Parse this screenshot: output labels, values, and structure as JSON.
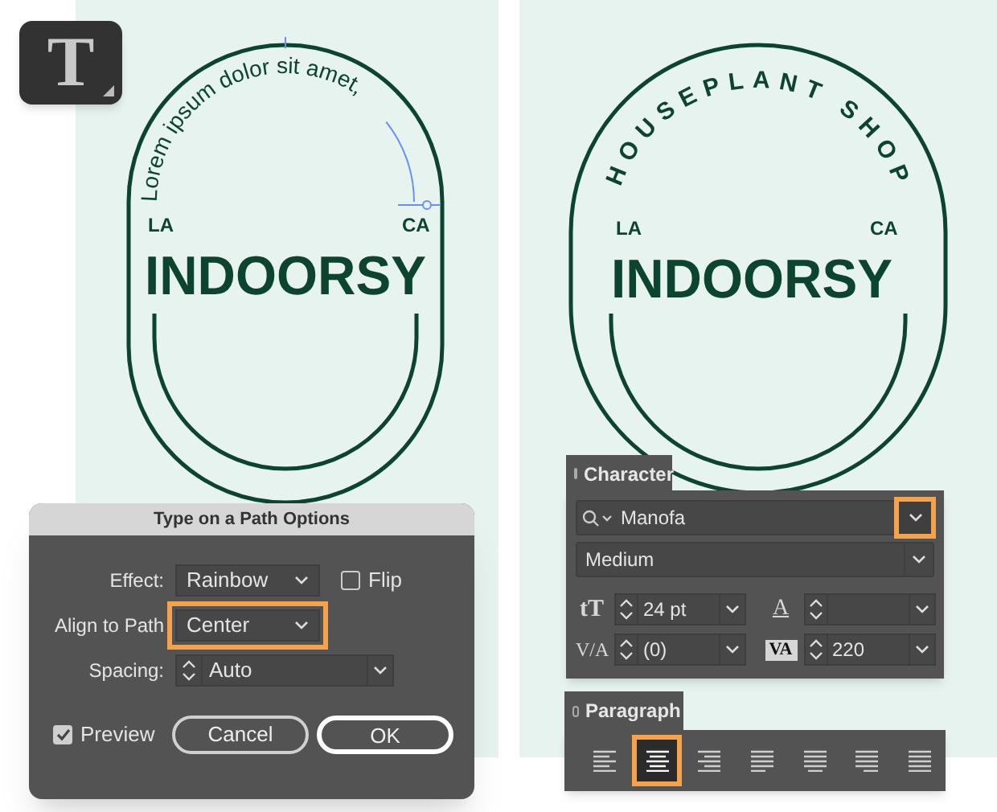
{
  "tool_icon": {
    "glyph": "T"
  },
  "artboards": [
    {
      "curved_text": "Lorem ipsum dolor sit amet,",
      "path_selected": true,
      "left_label": "LA",
      "right_label": "CA",
      "brand": "INDOORSY"
    },
    {
      "curved_text": "HOUSEPLANT SHOP",
      "path_selected": false,
      "left_label": "LA",
      "right_label": "CA",
      "brand": "INDOORSY"
    }
  ],
  "dialog": {
    "title": "Type on a Path Options",
    "fields": [
      {
        "kind": "select",
        "label": "Effect:",
        "value": "Rainbow",
        "highlighted": false
      },
      {
        "kind": "select",
        "label": "Align to Path",
        "value": "Center",
        "highlighted": true
      },
      {
        "kind": "stepper",
        "label": "Spacing:",
        "value": "Auto",
        "highlighted": false
      }
    ],
    "flip": {
      "label": "Flip",
      "checked": false
    },
    "preview": {
      "label": "Preview",
      "checked": true
    },
    "buttons": [
      {
        "label": "Cancel",
        "default": false
      },
      {
        "label": "OK",
        "default": true
      }
    ]
  },
  "character_panel": {
    "title": "Character",
    "font_family": {
      "value": "Manofa",
      "highlighted": true
    },
    "font_style": {
      "value": "Medium",
      "highlighted": false
    },
    "fields": [
      {
        "kind": "size",
        "icon": "tT",
        "value": "24 pt"
      },
      {
        "kind": "leading",
        "icon": "A"
      },
      {
        "kind": "kerning",
        "icon": "V/A",
        "value": "(0)"
      },
      {
        "kind": "tracking",
        "icon": "VA",
        "value": "220"
      }
    ]
  },
  "paragraph_panel": {
    "title": "Paragraph",
    "alignments": [
      {
        "kind": "left",
        "selected": false
      },
      {
        "kind": "center",
        "selected": true
      },
      {
        "kind": "right",
        "selected": false
      },
      {
        "kind": "justify-left",
        "selected": false
      },
      {
        "kind": "justify-center",
        "selected": false
      },
      {
        "kind": "justify-right",
        "selected": false
      },
      {
        "kind": "justify-all",
        "selected": false
      }
    ]
  }
}
